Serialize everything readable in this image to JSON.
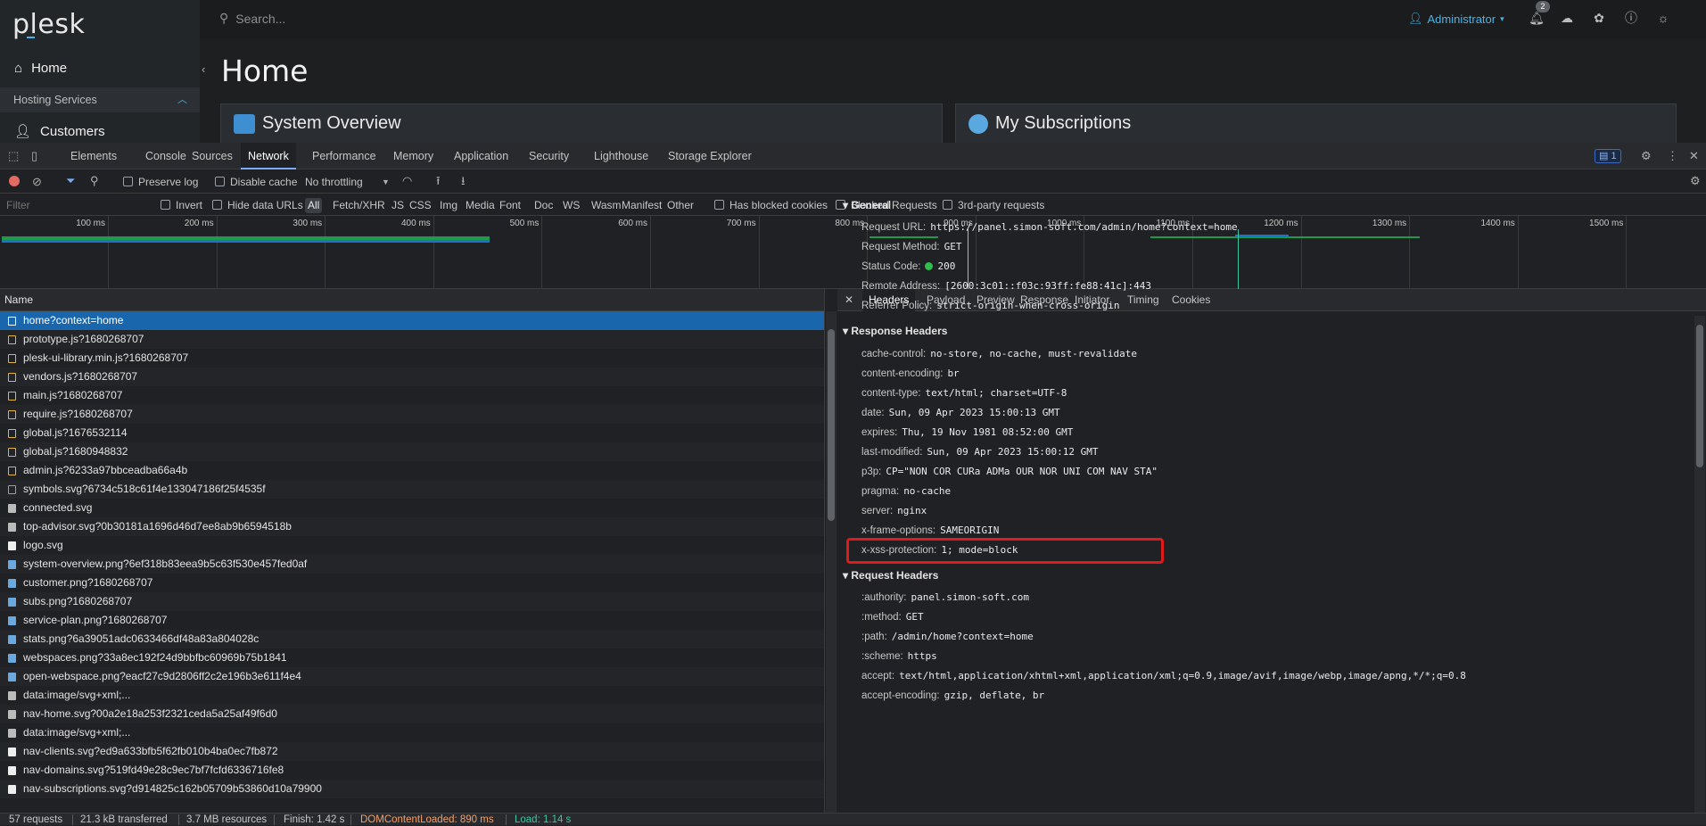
{
  "plesk": {
    "logo": "plesk",
    "nav_home": "Home",
    "section_label": "Hosting Services",
    "nav_customers": "Customers",
    "search_placeholder": "Search...",
    "user": "Administrator",
    "notif_count": "2",
    "page_title": "Home",
    "card1": "System Overview",
    "card2": "My Subscriptions",
    "colors": {
      "accent": "#4ab3e6"
    }
  },
  "devtools": {
    "tabs": [
      "Elements",
      "Console",
      "Sources",
      "Network",
      "Performance",
      "Memory",
      "Application",
      "Security",
      "Lighthouse",
      "Storage Explorer"
    ],
    "active_tab": "Network",
    "messages_count": "1",
    "toolbar": {
      "preserve_log": "Preserve log",
      "disable_cache": "Disable cache",
      "throttling": "No throttling"
    },
    "filter": {
      "placeholder": "Filter",
      "invert": "Invert",
      "hide_data_urls": "Hide data URLs",
      "types": [
        "All",
        "Fetch/XHR",
        "JS",
        "CSS",
        "Img",
        "Media",
        "Font",
        "Doc",
        "WS",
        "Wasm",
        "Manifest",
        "Other"
      ],
      "has_blocked_cookies": "Has blocked cookies",
      "blocked_requests": "Blocked Requests",
      "third_party": "3rd-party requests"
    },
    "timeline_ticks": [
      "100 ms",
      "200 ms",
      "300 ms",
      "400 ms",
      "500 ms",
      "600 ms",
      "700 ms",
      "800 ms",
      "900 ms",
      "1000 ms",
      "1100 ms",
      "1200 ms",
      "1300 ms",
      "1400 ms",
      "1500 ms"
    ],
    "list_header": "Name",
    "requests": [
      {
        "name": "home?context=home",
        "type": "doc"
      },
      {
        "name": "prototype.js?1680268707",
        "type": "js"
      },
      {
        "name": "plesk-ui-library.min.js?1680268707",
        "type": "js"
      },
      {
        "name": "vendors.js?1680268707",
        "type": "js"
      },
      {
        "name": "main.js?1680268707",
        "type": "js"
      },
      {
        "name": "require.js?1680268707",
        "type": "js"
      },
      {
        "name": "global.js?1676532114",
        "type": "js"
      },
      {
        "name": "global.js?1680948832",
        "type": "js"
      },
      {
        "name": "admin.js?6233a97bbceadba66a4b",
        "type": "js"
      },
      {
        "name": "symbols.svg?6734c518c61f4e133047186f25f4535f",
        "type": "doc"
      },
      {
        "name": "connected.svg",
        "type": "img"
      },
      {
        "name": "top-advisor.svg?0b30181a1696d46d7ee8ab9b6594518b",
        "type": "img"
      },
      {
        "name": "logo.svg",
        "type": "svg"
      },
      {
        "name": "system-overview.png?6ef318b83eea9b5c63f530e457fed0af",
        "type": "png"
      },
      {
        "name": "customer.png?1680268707",
        "type": "png"
      },
      {
        "name": "subs.png?1680268707",
        "type": "png"
      },
      {
        "name": "service-plan.png?1680268707",
        "type": "png"
      },
      {
        "name": "stats.png?6a39051adc0633466df48a83a804028c",
        "type": "png"
      },
      {
        "name": "webspaces.png?33a8ec192f24d9bbfbc60969b75b1841",
        "type": "png"
      },
      {
        "name": "open-webspace.png?eacf27c9d2806ff2c2e196b3e611f4e4",
        "type": "png"
      },
      {
        "name": "data:image/svg+xml;...",
        "type": "img"
      },
      {
        "name": "nav-home.svg?00a2e18a253f2321ceda5a25af49f6d0",
        "type": "img"
      },
      {
        "name": "data:image/svg+xml;...",
        "type": "img"
      },
      {
        "name": "nav-clients.svg?ed9a633bfb5f62fb010b4ba0ec7fb872",
        "type": "svg"
      },
      {
        "name": "nav-domains.svg?519fd49e28c9ec7bf7fcfd6336716fe8",
        "type": "svg"
      },
      {
        "name": "nav-subscriptions.svg?d914825c162b05709b53860d10a79900",
        "type": "svg"
      }
    ],
    "detail_tabs": [
      "Headers",
      "Payload",
      "Preview",
      "Response",
      "Initiator",
      "Timing",
      "Cookies"
    ],
    "detail_active": "Headers",
    "general_title": "General",
    "general": [
      {
        "k": "Request URL:",
        "v": "https://panel.simon-soft.com/admin/home?context=home"
      },
      {
        "k": "Request Method:",
        "v": "GET"
      },
      {
        "k": "Status Code:",
        "v": "200"
      },
      {
        "k": "Remote Address:",
        "v": "[2600:3c01::f03c:93ff:fe88:41c]:443"
      },
      {
        "k": "Referrer Policy:",
        "v": "strict-origin-when-cross-origin"
      }
    ],
    "response_title": "Response Headers",
    "response_headers": [
      {
        "k": "cache-control:",
        "v": "no-store, no-cache, must-revalidate"
      },
      {
        "k": "content-encoding:",
        "v": "br"
      },
      {
        "k": "content-type:",
        "v": "text/html; charset=UTF-8"
      },
      {
        "k": "date:",
        "v": "Sun, 09 Apr 2023 15:00:13 GMT"
      },
      {
        "k": "expires:",
        "v": "Thu, 19 Nov 1981 08:52:00 GMT"
      },
      {
        "k": "last-modified:",
        "v": "Sun, 09 Apr 2023 15:00:12 GMT"
      },
      {
        "k": "p3p:",
        "v": "CP=\"NON COR CURa ADMa OUR NOR UNI COM NAV STA\""
      },
      {
        "k": "pragma:",
        "v": "no-cache"
      },
      {
        "k": "server:",
        "v": "nginx"
      },
      {
        "k": "x-frame-options:",
        "v": "SAMEORIGIN"
      },
      {
        "k": "x-xss-protection:",
        "v": "1; mode=block"
      }
    ],
    "request_title": "Request Headers",
    "request_headers": [
      {
        "k": ":authority:",
        "v": "panel.simon-soft.com"
      },
      {
        "k": ":method:",
        "v": "GET"
      },
      {
        "k": ":path:",
        "v": "/admin/home?context=home"
      },
      {
        "k": ":scheme:",
        "v": "https"
      },
      {
        "k": "accept:",
        "v": "text/html,application/xhtml+xml,application/xml;q=0.9,image/avif,image/webp,image/apng,*/*;q=0.8"
      },
      {
        "k": "accept-encoding:",
        "v": "gzip, deflate, br"
      }
    ],
    "status": {
      "requests": "57 requests",
      "transferred": "21.3 kB transferred",
      "resources": "3.7 MB resources",
      "finish": "Finish: 1.42 s",
      "dcl": "DOMContentLoaded: 890 ms",
      "load": "Load: 1.14 s"
    },
    "colors": {
      "dcl": "#f29f6b",
      "load": "#3cc6a0",
      "selected": "#1a66ad",
      "highlight": "#e0191a"
    }
  }
}
